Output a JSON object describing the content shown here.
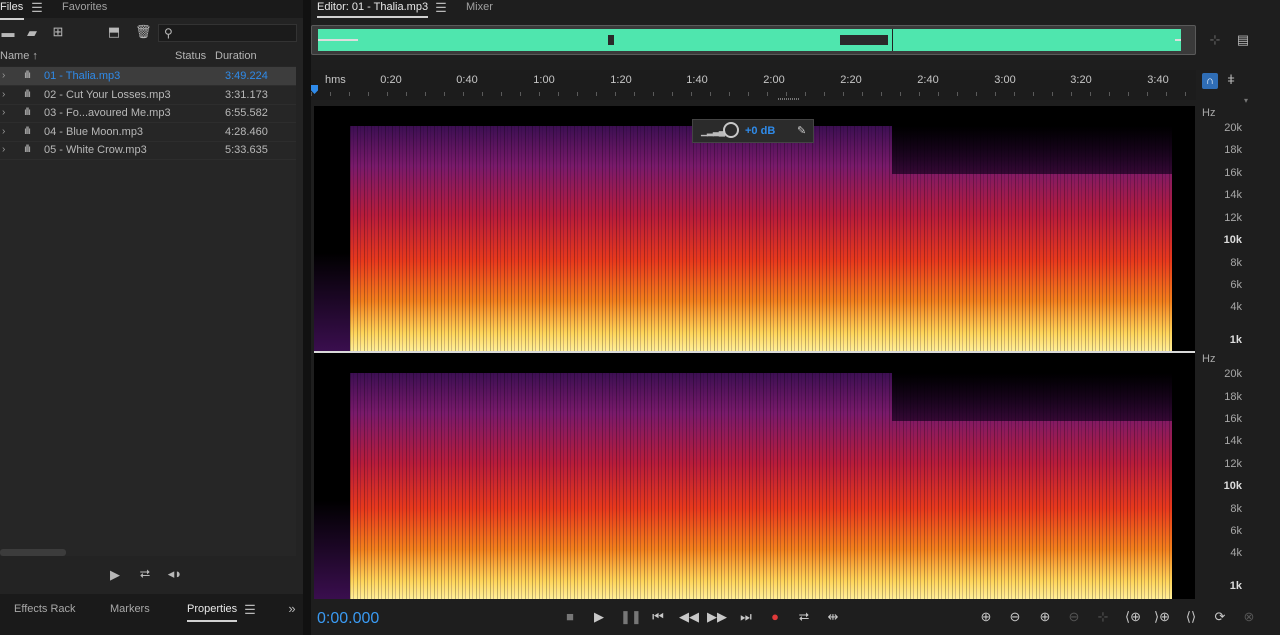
{
  "left_panel": {
    "tabs": [
      "Files",
      "Favorites"
    ],
    "search_placeholder": "",
    "columns": {
      "name": "Name",
      "status": "Status",
      "duration": "Duration"
    },
    "files": [
      {
        "name": "01 - Thalia.mp3",
        "duration": "3:49.224",
        "selected": true
      },
      {
        "name": "02 - Cut Your Losses.mp3",
        "duration": "3:31.173",
        "selected": false
      },
      {
        "name": "03 - Fo...avoured Me.mp3",
        "duration": "6:55.582",
        "selected": false
      },
      {
        "name": "04 - Blue Moon.mp3",
        "duration": "4:28.460",
        "selected": false
      },
      {
        "name": "05 - White Crow.mp3",
        "duration": "5:33.635",
        "selected": false
      }
    ],
    "bottom_tabs": [
      "Effects Rack",
      "Markers",
      "Properties"
    ]
  },
  "editor": {
    "tabs": [
      "Editor: 01 - Thalia.mp3",
      "Mixer"
    ],
    "ruler": {
      "unit_label": "hms",
      "ticks": [
        "0:20",
        "0:40",
        "1:00",
        "1:20",
        "1:40",
        "2:00",
        "2:20",
        "2:40",
        "3:00",
        "3:20",
        "3:40"
      ]
    },
    "hud": {
      "gain_label": "+0 dB"
    },
    "hz_axis": {
      "unit": "Hz",
      "labels": [
        "20k",
        "18k",
        "16k",
        "14k",
        "12k",
        "10k",
        "8k",
        "6k",
        "4k",
        "1k"
      ]
    },
    "time_display": "0:00.000"
  },
  "colors": {
    "accent": "#2f8bea",
    "overview_wave": "#4fe6ae",
    "spectral_low": "#ffe97a",
    "spectral_mid": "#f06a1a",
    "spectral_high": "#6a1a8a"
  }
}
